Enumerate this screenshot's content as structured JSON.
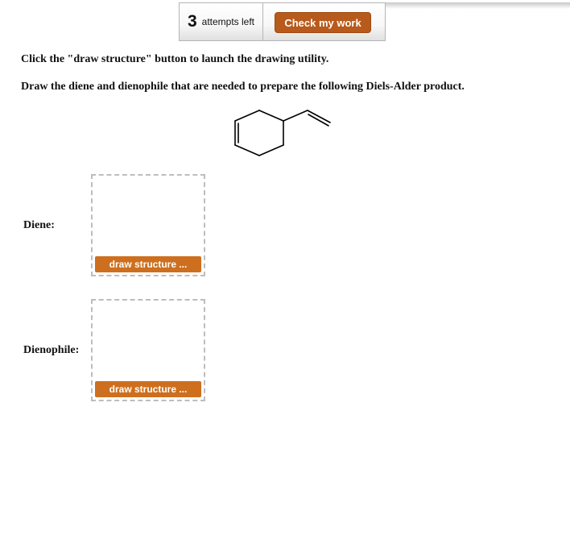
{
  "header": {
    "attempts_count": "3",
    "attempts_label": "attempts left",
    "check_button_label": "Check my work"
  },
  "instructions": {
    "line1": "Click the \"draw structure\" button to launch the drawing utility.",
    "line2": "Draw the diene and dienophile that are needed to prepare the following Diels-Alder product."
  },
  "product": {
    "name": "4-vinylcyclohexene structure"
  },
  "answers": [
    {
      "label": "Diene:",
      "button_label": "draw structure ..."
    },
    {
      "label": "Dienophile:",
      "button_label": "draw structure ..."
    }
  ],
  "colors": {
    "check_button": "#b85a1b",
    "draw_button": "#cd6f1e"
  }
}
